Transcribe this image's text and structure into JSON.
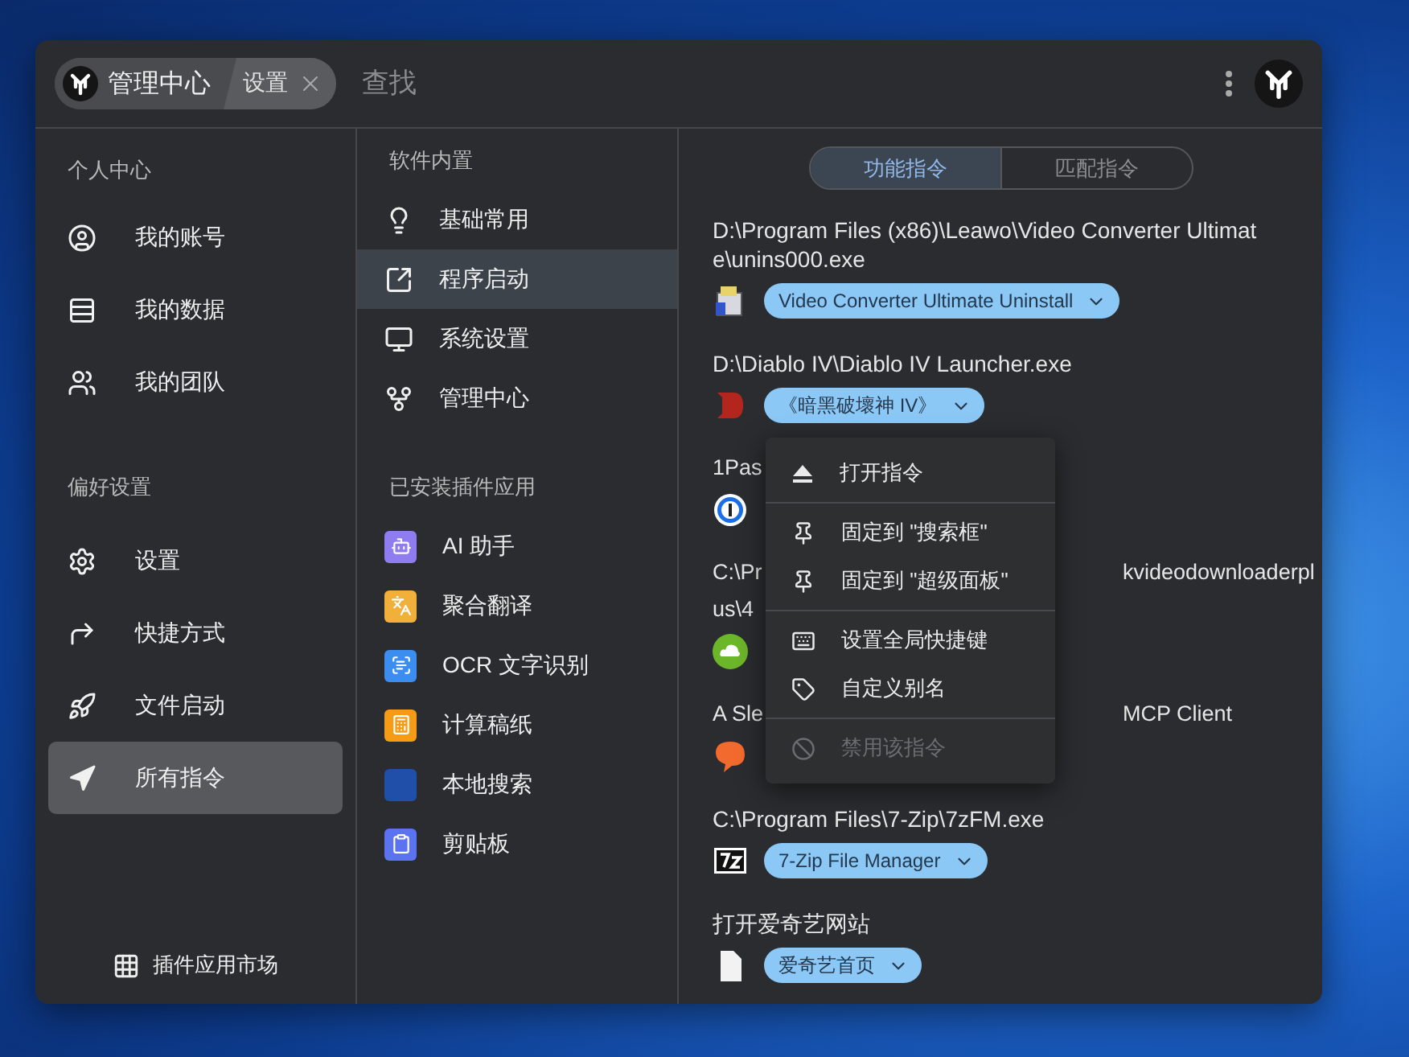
{
  "header": {
    "breadcrumb": [
      {
        "kind": "logo",
        "label": "管理中心"
      },
      {
        "kind": "closable",
        "label": "设置"
      }
    ],
    "search": {
      "placeholder": "查找"
    }
  },
  "left_nav": {
    "sections": [
      {
        "title": "个人中心",
        "items": [
          {
            "label": "我的账号",
            "selected": false
          },
          {
            "label": "我的数据",
            "selected": false
          },
          {
            "label": "我的团队",
            "selected": false
          }
        ]
      },
      {
        "title": "偏好设置",
        "items": [
          {
            "label": "设置",
            "selected": false
          },
          {
            "label": "快捷方式",
            "selected": false
          },
          {
            "label": "文件启动",
            "selected": false
          },
          {
            "label": "所有指令",
            "selected": true
          }
        ]
      }
    ],
    "footer": {
      "label": "插件应用市场"
    }
  },
  "mid_nav": {
    "sections": [
      {
        "title": "软件内置",
        "items": [
          {
            "label": "基础常用",
            "selected": false
          },
          {
            "label": "程序启动",
            "selected": true
          },
          {
            "label": "系统设置",
            "selected": false
          },
          {
            "label": "管理中心",
            "selected": false
          }
        ]
      },
      {
        "title": "已安装插件应用",
        "items": [
          {
            "label": "AI 助手",
            "selected": false
          },
          {
            "label": "聚合翻译",
            "selected": false
          },
          {
            "label": "OCR 文字识别",
            "selected": false
          },
          {
            "label": "计算稿纸",
            "selected": false
          },
          {
            "label": "本地搜索",
            "selected": false
          },
          {
            "label": "剪贴板",
            "selected": false
          }
        ]
      }
    ]
  },
  "tabs": [
    {
      "label": "功能指令",
      "selected": true
    },
    {
      "label": "匹配指令",
      "selected": false
    }
  ],
  "commands": [
    {
      "kind": "full",
      "path": "D:\\Program Files (x86)\\Leawo\\Video Converter Ultimate\\unins000.exe",
      "chip": "Video Converter Ultimate Uninstall"
    },
    {
      "kind": "full",
      "path": "D:\\Diablo IV\\Diablo IV Launcher.exe",
      "chip": "《暗黑破壞神 IV》"
    },
    {
      "kind": "covered",
      "lines": [
        [
          "1Pas"
        ]
      ]
    },
    {
      "kind": "covered",
      "lines": [
        [
          "C:\\Pr",
          "kvideodownloaderpl"
        ],
        [
          "us\\4"
        ]
      ]
    },
    {
      "kind": "covered",
      "lines": [
        [
          "A Sle",
          "MCP Client"
        ]
      ]
    },
    {
      "kind": "full",
      "path": "C:\\Program Files\\7-Zip\\7zFM.exe",
      "chip": "7-Zip File Manager"
    },
    {
      "kind": "full",
      "path": "打开爱奇艺网站",
      "chip": "爱奇艺首页"
    }
  ],
  "context_menu": {
    "groups": [
      [
        {
          "label": "打开指令",
          "disabled": false
        }
      ],
      [
        {
          "label": "固定到 \"搜索框\"",
          "disabled": false
        },
        {
          "label": "固定到 \"超级面板\"",
          "disabled": false
        }
      ],
      [
        {
          "label": "设置全局快捷键",
          "disabled": false
        },
        {
          "label": "自定义别名",
          "disabled": false
        }
      ],
      [
        {
          "label": "禁用该指令",
          "disabled": true
        }
      ]
    ]
  }
}
